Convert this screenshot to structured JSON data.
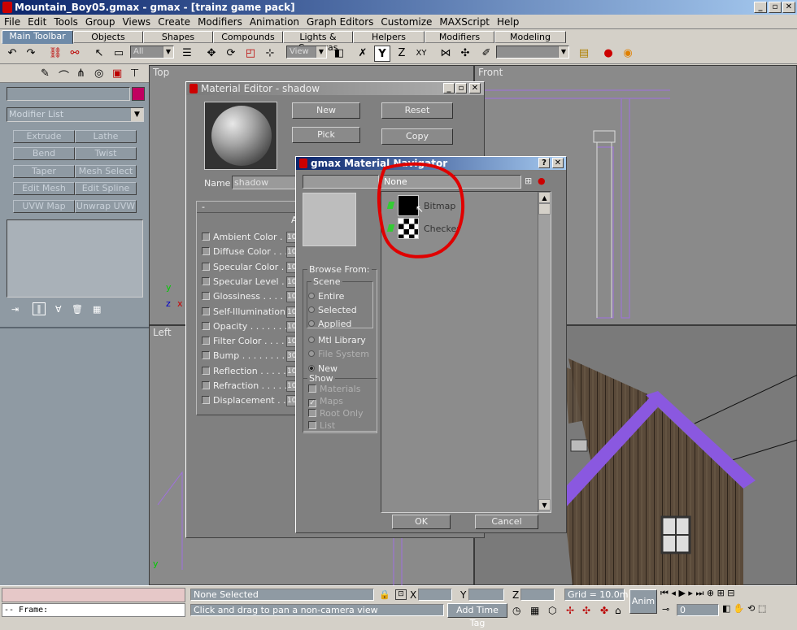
{
  "app": {
    "title": "Mountain_Boy05.gmax - gmax - [trainz game pack]",
    "minimize": "_",
    "maximize": "▫",
    "close": "✕"
  },
  "menu": [
    "File",
    "Edit",
    "Tools",
    "Group",
    "Views",
    "Create",
    "Modifiers",
    "Animation",
    "Graph Editors",
    "Customize",
    "MAXScript",
    "Help"
  ],
  "tabs": [
    "Main Toolbar",
    "Objects",
    "Shapes",
    "Compounds",
    "Lights & Cameras",
    "Helpers",
    "Modifiers",
    "Modeling"
  ],
  "toolbar": {
    "selection_filter": "All",
    "ref_coord": "View",
    "xy_label": "XY",
    "icons": [
      "undo",
      "redo",
      "select-link",
      "unlink",
      "select",
      "select-region",
      "select-by-name",
      "move",
      "rotate",
      "scale",
      "pivot",
      "mirror",
      "align",
      "snap",
      "named-selection",
      "render",
      "quick-render"
    ]
  },
  "command_panel": {
    "modifier_list": "Modifier List",
    "color": "#c00060",
    "buttons": [
      "Extrude",
      "Lathe",
      "Bend",
      "Twist",
      "Taper",
      "Mesh Select",
      "Edit Mesh",
      "Edit Spline",
      "UVW Map",
      "Unwrap UVW"
    ]
  },
  "viewports": {
    "top": "Top",
    "front": "Front",
    "left": "Left",
    "axis_y": "y",
    "axis_z": "z",
    "axis_x": "x"
  },
  "material_editor": {
    "title": "Material Editor - shadow",
    "name_label": "Name",
    "name_value": "shadow",
    "buttons": {
      "new": "New",
      "reset": "Reset",
      "pick": "Pick",
      "copy": "Copy"
    },
    "rollout_minus": "-",
    "rollout_letter": "A",
    "maps": [
      {
        "label": "Ambient Color",
        "dots": " . . . . . . ",
        "amt": "10"
      },
      {
        "label": "Diffuse Color",
        "dots": " . . . . . . ",
        "amt": "10"
      },
      {
        "label": "Specular Color",
        "dots": " . . . . ",
        "amt": "10"
      },
      {
        "label": "Specular Level",
        "dots": " . . . . ",
        "amt": "10"
      },
      {
        "label": "Glossiness",
        "dots": " . . . . . . . ",
        "amt": "10"
      },
      {
        "label": "Self-Illumination",
        "dots": " . . . ",
        "amt": "10"
      },
      {
        "label": "Opacity",
        "dots": " . . . . . . . . . ",
        "amt": "10"
      },
      {
        "label": "Filter Color",
        "dots": " . . . . . . . ",
        "amt": "10"
      },
      {
        "label": "Bump",
        "dots": " . . . . . . . . . . . . ",
        "amt": "30"
      },
      {
        "label": "Reflection",
        "dots": " . . . . . . . . ",
        "amt": "10"
      },
      {
        "label": "Refraction",
        "dots": " . . . . . . . . ",
        "amt": "10"
      },
      {
        "label": "Displacement",
        "dots": " . . . . ",
        "amt": "10"
      }
    ]
  },
  "navigator": {
    "title": "gmax Material Navigator",
    "help": "?",
    "close": "✕",
    "path": "None",
    "browse_from": "Browse From:",
    "scene": "Scene",
    "options": [
      {
        "label": "Entire",
        "state": "off"
      },
      {
        "label": "Selected",
        "state": "off"
      },
      {
        "label": "Applied",
        "state": "off"
      },
      {
        "label": "Mtl Library",
        "state": "off"
      },
      {
        "label": "File System",
        "state": "off"
      },
      {
        "label": "New",
        "state": "on"
      }
    ],
    "show": "Show",
    "show_options": [
      {
        "label": "Materials",
        "checked": false
      },
      {
        "label": "Maps",
        "checked": true
      },
      {
        "label": "Root Only",
        "checked": false
      },
      {
        "label": "List",
        "checked": false
      }
    ],
    "items": [
      "Bitmap",
      "Checker"
    ],
    "ok": "OK",
    "cancel": "Cancel"
  },
  "statusbar": {
    "selected": "None Selected",
    "prompt": "Click and drag to pan a non-camera view",
    "frame": "-- Frame:",
    "x": "X",
    "y": "Y",
    "z": "Z",
    "grid": "Grid = 10.0m",
    "add_time_tag": "Add Time Tag",
    "anim": "Anim",
    "frame_value": "0"
  },
  "annotation_color": "#e00000"
}
